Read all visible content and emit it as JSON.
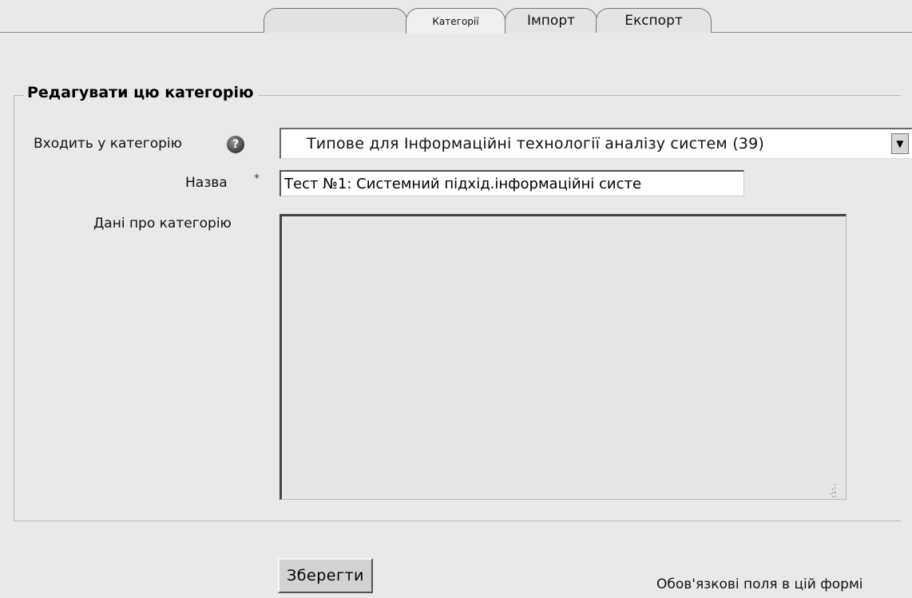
{
  "tabs": [
    {
      "label": ""
    },
    {
      "label": "Категорії"
    },
    {
      "label": "Імпорт"
    },
    {
      "label": "Експорт"
    }
  ],
  "form": {
    "legend": "Редагувати цю категорію",
    "parent_label": "Входить у категорію",
    "parent_value": "Типове для Інформаційні технології аналізу систем (39)",
    "name_label": "Назва",
    "name_required_marker": "*",
    "name_value": "Тест №1: Системний підхід.інформаційні систе",
    "info_label": "Дані про категорію",
    "info_value": "",
    "save_label": "Зберегти",
    "required_note": "Обов'язкові поля в цій формі"
  },
  "icons": {
    "help": "help-icon",
    "dropdown": "chevron-down-icon",
    "resize": "resize-grip-icon"
  }
}
